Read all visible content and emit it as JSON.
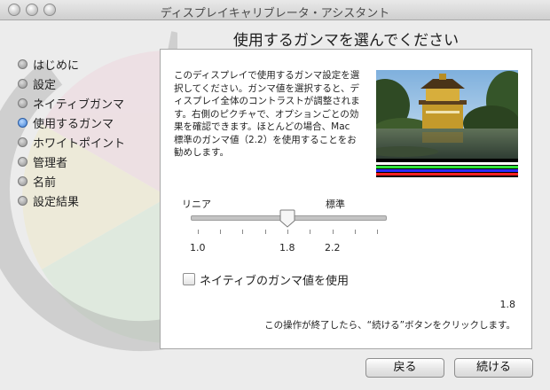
{
  "window": {
    "title": "ディスプレイキャリブレータ・アシスタント"
  },
  "page_heading": "使用するガンマを選んでください",
  "steps": [
    {
      "label": "はじめに",
      "active": false
    },
    {
      "label": "設定",
      "active": false
    },
    {
      "label": "ネイティブガンマ",
      "active": false
    },
    {
      "label": "使用するガンマ",
      "active": true
    },
    {
      "label": "ホワイトポイント",
      "active": false
    },
    {
      "label": "管理者",
      "active": false
    },
    {
      "label": "名前",
      "active": false
    },
    {
      "label": "設定結果",
      "active": false
    }
  ],
  "panel": {
    "description_lines": [
      "このディスプレイで使用するガンマ設定を選",
      "択してください。ガンマ値を選択すると、デ",
      "ィスプレイ全体のコントラストが調整されま",
      "す。右側のピクチャで、オプションごとの効",
      "果を確認できます。ほとんどの場合、Mac",
      "標準のガンマ値（2.2）を使用することをお",
      "勧めします。"
    ],
    "slider": {
      "label_left": "リニア",
      "label_right": "標準",
      "min": 1.0,
      "max": 2.6,
      "value": 1.8,
      "tick_labels": [
        "1.0",
        "1.8",
        "2.2"
      ]
    },
    "checkbox_label": "ネイティブのガンマ値を使用",
    "checkbox_checked": false,
    "value_readout": "1.8",
    "hint": "この操作が終了したら、“続ける”ボタンをクリックします。"
  },
  "buttons": {
    "back": "戻る",
    "continue": "続ける"
  },
  "colors": {
    "selection": "#3d7fd6",
    "panel_background": "#ffffff"
  }
}
